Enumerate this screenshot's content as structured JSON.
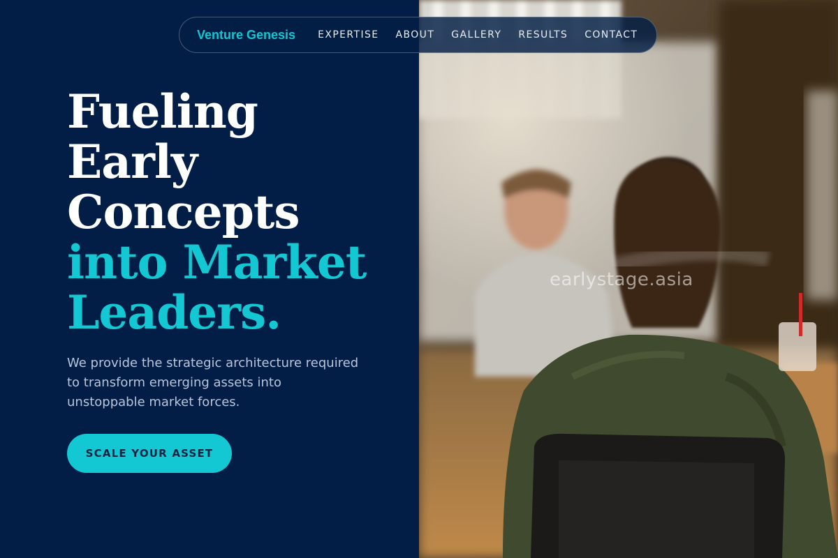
{
  "nav": {
    "brand": "Venture Genesis",
    "links": [
      "EXPERTISE",
      "ABOUT",
      "GALLERY",
      "RESULTS",
      "CONTACT"
    ]
  },
  "hero": {
    "title_lines": [
      "Fueling",
      "Early",
      "Concepts"
    ],
    "title_accent_lines": [
      "into Market",
      "Leaders."
    ],
    "description": "We provide the strategic architecture required to transform emerging assets into unstoppable market forces.",
    "cta_label": "SCALE YOUR ASSET"
  },
  "image": {
    "watermark": "earlystage.asia"
  },
  "colors": {
    "background": "#021e46",
    "accent": "#14c8d3",
    "text": "#ffffff",
    "muted_text": "#b9c6dc"
  }
}
